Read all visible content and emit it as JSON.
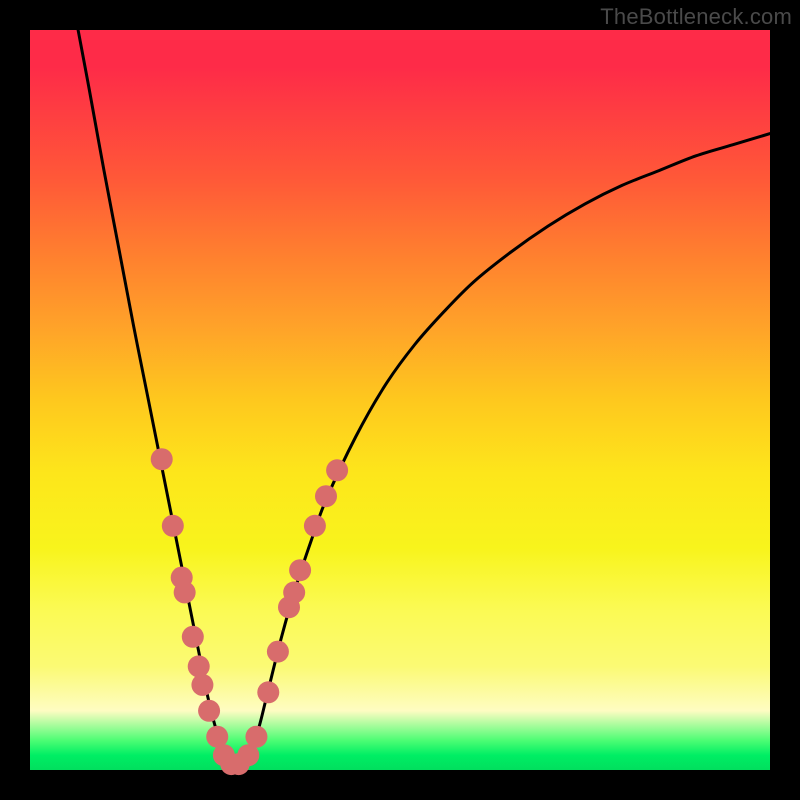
{
  "watermark": "TheBottleneck.com",
  "chart_data": {
    "type": "line",
    "title": "",
    "xlabel": "",
    "ylabel": "",
    "xlim": [
      0,
      100
    ],
    "ylim": [
      0,
      100
    ],
    "grid": false,
    "legend": false,
    "series": [
      {
        "name": "bottleneck-curve",
        "color": "#000000",
        "x": [
          6.5,
          8,
          10,
          12,
          14,
          16,
          17.5,
          19,
          20,
          21,
          22,
          23,
          24,
          25,
          26,
          27,
          28,
          29,
          30,
          31,
          32,
          34,
          36,
          38,
          40,
          44,
          48,
          52,
          56,
          60,
          65,
          70,
          75,
          80,
          85,
          90,
          95,
          100
        ],
        "y": [
          100,
          92,
          81,
          70.5,
          60,
          50,
          42.5,
          35,
          30,
          25,
          20,
          15,
          10,
          6,
          3,
          1,
          0.5,
          1,
          3,
          6,
          10,
          18,
          25,
          31,
          36.5,
          45,
          52,
          57.5,
          62,
          66,
          70,
          73.5,
          76.5,
          79,
          81,
          83,
          84.5,
          86
        ]
      }
    ],
    "markers": [
      {
        "x": 17.8,
        "y": 42
      },
      {
        "x": 19.3,
        "y": 33
      },
      {
        "x": 20.5,
        "y": 26
      },
      {
        "x": 20.9,
        "y": 24
      },
      {
        "x": 22.0,
        "y": 18
      },
      {
        "x": 22.8,
        "y": 14
      },
      {
        "x": 23.3,
        "y": 11.5
      },
      {
        "x": 24.2,
        "y": 8
      },
      {
        "x": 25.3,
        "y": 4.5
      },
      {
        "x": 26.2,
        "y": 2
      },
      {
        "x": 27.2,
        "y": 0.8
      },
      {
        "x": 28.2,
        "y": 0.8
      },
      {
        "x": 29.5,
        "y": 2
      },
      {
        "x": 30.6,
        "y": 4.5
      },
      {
        "x": 32.2,
        "y": 10.5
      },
      {
        "x": 33.5,
        "y": 16
      },
      {
        "x": 35.0,
        "y": 22
      },
      {
        "x": 35.7,
        "y": 24
      },
      {
        "x": 36.5,
        "y": 27
      },
      {
        "x": 38.5,
        "y": 33
      },
      {
        "x": 40.0,
        "y": 37
      },
      {
        "x": 41.5,
        "y": 40.5
      }
    ],
    "marker_style": {
      "color": "#d86c6c",
      "radius_px": 11
    }
  }
}
